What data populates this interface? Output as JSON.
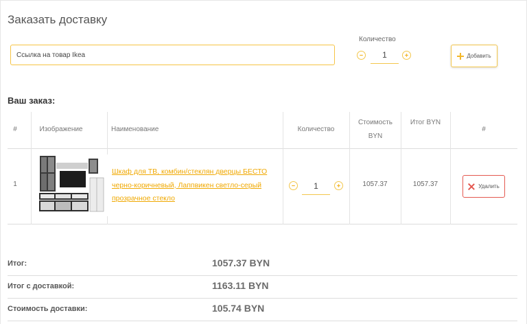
{
  "page": {
    "title": "Заказать доставку"
  },
  "add_form": {
    "link_placeholder": "Ссылка на товар Ikea",
    "quantity_label": "Количество",
    "quantity_value": "1",
    "add_label": "Добавить"
  },
  "order": {
    "heading": "Ваш заказ:",
    "columns": [
      "#",
      "Изображение",
      "Наименование",
      "Количество",
      "Стоимость BYN",
      "Итог BYN",
      "#"
    ],
    "rows": [
      {
        "index": "1",
        "name": "Шкаф для ТВ, комбин/стеклян дверцы БЕСТО черно-коричневый, Лаппвикен светло-серый прозрачное стекло",
        "quantity": "1",
        "price": "1057.37",
        "total": "1057.37",
        "delete_label": "Удалить"
      }
    ]
  },
  "summary": [
    {
      "label": "Итог:",
      "value": "1057.37 BYN"
    },
    {
      "label": "Итог с доставкой:",
      "value": "1163.11 BYN"
    },
    {
      "label": "Стоимость доставки:",
      "value": "105.74 BYN"
    }
  ],
  "colors": {
    "accent": "#f3c64a",
    "link": "#f0a800",
    "danger": "#e4574f"
  },
  "icons": [
    "minus-circle-icon",
    "plus-circle-icon",
    "plus-icon",
    "close-icon"
  ]
}
